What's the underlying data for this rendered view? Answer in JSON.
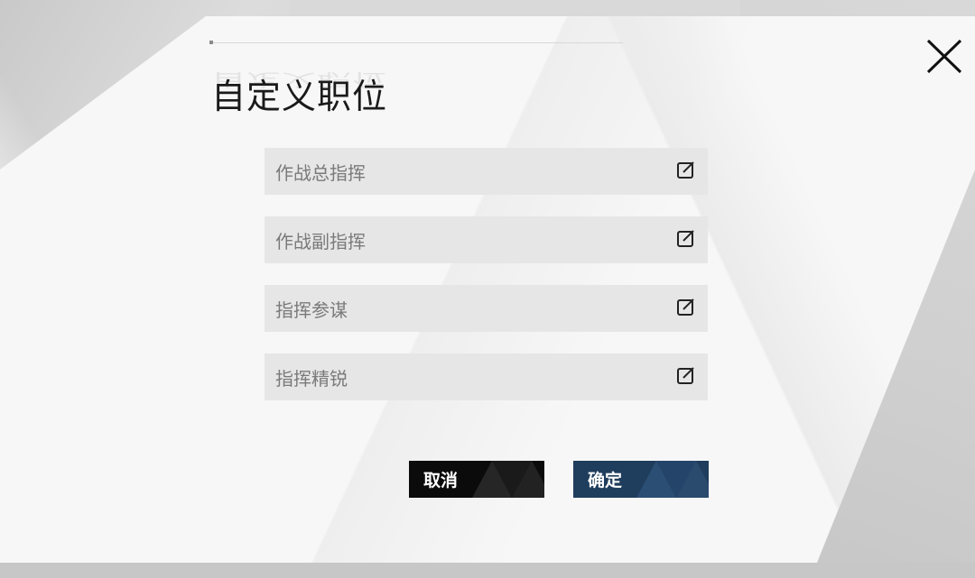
{
  "dialog": {
    "title": "自定义职位",
    "fields": [
      {
        "label": "作战总指挥"
      },
      {
        "label": "作战副指挥"
      },
      {
        "label": "指挥参谋"
      },
      {
        "label": "指挥精锐"
      }
    ],
    "buttons": {
      "cancel_label": "取消",
      "confirm_label": "确定"
    },
    "icons": {
      "close": "close-icon",
      "edit": "edit-icon"
    },
    "colors": {
      "cancel_button": "#0b0b0b",
      "confirm_button": "#1f3d5c",
      "field_background": "#e6e6e6"
    }
  }
}
